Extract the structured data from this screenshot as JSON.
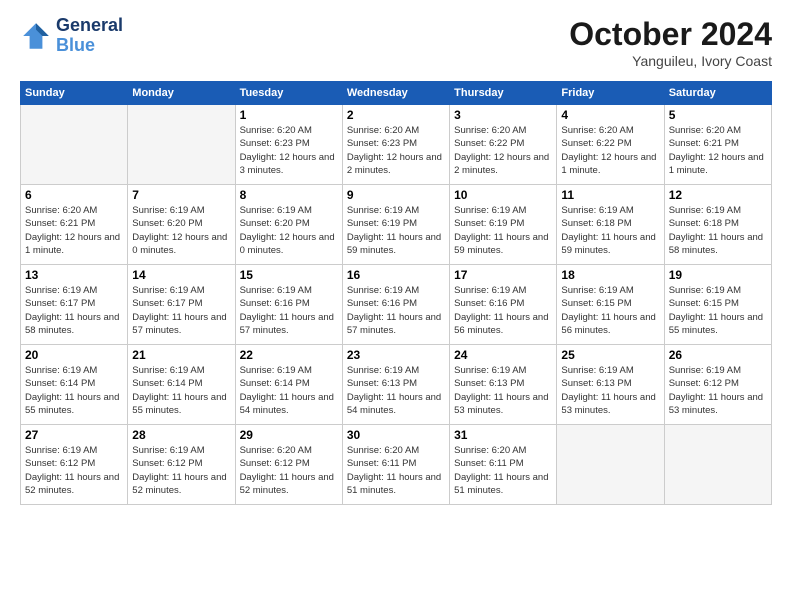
{
  "header": {
    "logo_line1": "General",
    "logo_line2": "Blue",
    "month": "October 2024",
    "location": "Yanguileu, Ivory Coast"
  },
  "days_of_week": [
    "Sunday",
    "Monday",
    "Tuesday",
    "Wednesday",
    "Thursday",
    "Friday",
    "Saturday"
  ],
  "weeks": [
    [
      {
        "day": "",
        "empty": true
      },
      {
        "day": "",
        "empty": true
      },
      {
        "day": "1",
        "info": "Sunrise: 6:20 AM\nSunset: 6:23 PM\nDaylight: 12 hours and 3 minutes."
      },
      {
        "day": "2",
        "info": "Sunrise: 6:20 AM\nSunset: 6:23 PM\nDaylight: 12 hours and 2 minutes."
      },
      {
        "day": "3",
        "info": "Sunrise: 6:20 AM\nSunset: 6:22 PM\nDaylight: 12 hours and 2 minutes."
      },
      {
        "day": "4",
        "info": "Sunrise: 6:20 AM\nSunset: 6:22 PM\nDaylight: 12 hours and 1 minute."
      },
      {
        "day": "5",
        "info": "Sunrise: 6:20 AM\nSunset: 6:21 PM\nDaylight: 12 hours and 1 minute."
      }
    ],
    [
      {
        "day": "6",
        "info": "Sunrise: 6:20 AM\nSunset: 6:21 PM\nDaylight: 12 hours and 1 minute."
      },
      {
        "day": "7",
        "info": "Sunrise: 6:19 AM\nSunset: 6:20 PM\nDaylight: 12 hours and 0 minutes."
      },
      {
        "day": "8",
        "info": "Sunrise: 6:19 AM\nSunset: 6:20 PM\nDaylight: 12 hours and 0 minutes."
      },
      {
        "day": "9",
        "info": "Sunrise: 6:19 AM\nSunset: 6:19 PM\nDaylight: 11 hours and 59 minutes."
      },
      {
        "day": "10",
        "info": "Sunrise: 6:19 AM\nSunset: 6:19 PM\nDaylight: 11 hours and 59 minutes."
      },
      {
        "day": "11",
        "info": "Sunrise: 6:19 AM\nSunset: 6:18 PM\nDaylight: 11 hours and 59 minutes."
      },
      {
        "day": "12",
        "info": "Sunrise: 6:19 AM\nSunset: 6:18 PM\nDaylight: 11 hours and 58 minutes."
      }
    ],
    [
      {
        "day": "13",
        "info": "Sunrise: 6:19 AM\nSunset: 6:17 PM\nDaylight: 11 hours and 58 minutes."
      },
      {
        "day": "14",
        "info": "Sunrise: 6:19 AM\nSunset: 6:17 PM\nDaylight: 11 hours and 57 minutes."
      },
      {
        "day": "15",
        "info": "Sunrise: 6:19 AM\nSunset: 6:16 PM\nDaylight: 11 hours and 57 minutes."
      },
      {
        "day": "16",
        "info": "Sunrise: 6:19 AM\nSunset: 6:16 PM\nDaylight: 11 hours and 57 minutes."
      },
      {
        "day": "17",
        "info": "Sunrise: 6:19 AM\nSunset: 6:16 PM\nDaylight: 11 hours and 56 minutes."
      },
      {
        "day": "18",
        "info": "Sunrise: 6:19 AM\nSunset: 6:15 PM\nDaylight: 11 hours and 56 minutes."
      },
      {
        "day": "19",
        "info": "Sunrise: 6:19 AM\nSunset: 6:15 PM\nDaylight: 11 hours and 55 minutes."
      }
    ],
    [
      {
        "day": "20",
        "info": "Sunrise: 6:19 AM\nSunset: 6:14 PM\nDaylight: 11 hours and 55 minutes."
      },
      {
        "day": "21",
        "info": "Sunrise: 6:19 AM\nSunset: 6:14 PM\nDaylight: 11 hours and 55 minutes."
      },
      {
        "day": "22",
        "info": "Sunrise: 6:19 AM\nSunset: 6:14 PM\nDaylight: 11 hours and 54 minutes."
      },
      {
        "day": "23",
        "info": "Sunrise: 6:19 AM\nSunset: 6:13 PM\nDaylight: 11 hours and 54 minutes."
      },
      {
        "day": "24",
        "info": "Sunrise: 6:19 AM\nSunset: 6:13 PM\nDaylight: 11 hours and 53 minutes."
      },
      {
        "day": "25",
        "info": "Sunrise: 6:19 AM\nSunset: 6:13 PM\nDaylight: 11 hours and 53 minutes."
      },
      {
        "day": "26",
        "info": "Sunrise: 6:19 AM\nSunset: 6:12 PM\nDaylight: 11 hours and 53 minutes."
      }
    ],
    [
      {
        "day": "27",
        "info": "Sunrise: 6:19 AM\nSunset: 6:12 PM\nDaylight: 11 hours and 52 minutes."
      },
      {
        "day": "28",
        "info": "Sunrise: 6:19 AM\nSunset: 6:12 PM\nDaylight: 11 hours and 52 minutes."
      },
      {
        "day": "29",
        "info": "Sunrise: 6:20 AM\nSunset: 6:12 PM\nDaylight: 11 hours and 52 minutes."
      },
      {
        "day": "30",
        "info": "Sunrise: 6:20 AM\nSunset: 6:11 PM\nDaylight: 11 hours and 51 minutes."
      },
      {
        "day": "31",
        "info": "Sunrise: 6:20 AM\nSunset: 6:11 PM\nDaylight: 11 hours and 51 minutes."
      },
      {
        "day": "",
        "empty": true
      },
      {
        "day": "",
        "empty": true
      }
    ]
  ]
}
